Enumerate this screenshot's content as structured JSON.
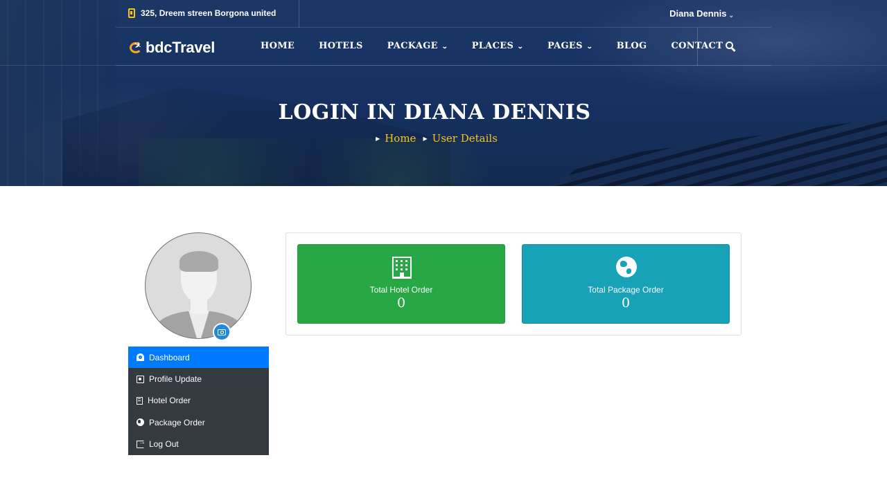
{
  "topbar": {
    "address": "325, Dreem streen Borgona united",
    "user_name": "Diana Dennis",
    "user_caret": "⌄"
  },
  "brand": {
    "logo_text": "bdcTravel"
  },
  "nav": {
    "items": [
      {
        "label": "HOME",
        "has_dropdown": false
      },
      {
        "label": "HOTELS",
        "has_dropdown": false
      },
      {
        "label": "PACKAGE",
        "has_dropdown": true
      },
      {
        "label": "PLACES",
        "has_dropdown": true
      },
      {
        "label": "PAGES",
        "has_dropdown": true
      },
      {
        "label": "BLOG",
        "has_dropdown": false
      },
      {
        "label": "CONTACT",
        "has_dropdown": false
      }
    ],
    "chevron": "⌄",
    "search_icon": "search-icon"
  },
  "hero": {
    "title": "LOGIN IN DIANA DENNIS",
    "breadcrumb": [
      "Home",
      "User Details"
    ],
    "breadcrumb_arrow": "▶"
  },
  "profile": {
    "avatar_icon": "user-placeholder-avatar",
    "camera_icon": "camera-icon"
  },
  "sidebar": {
    "items": [
      {
        "label": "Dashboard",
        "icon": "tachometer-icon",
        "active": true
      },
      {
        "label": "Profile Update",
        "icon": "address-card-icon",
        "active": false
      },
      {
        "label": "Hotel Order",
        "icon": "building-icon",
        "active": false
      },
      {
        "label": "Package Order",
        "icon": "globe-icon",
        "active": false
      },
      {
        "label": "Log Out",
        "icon": "sign-out-icon",
        "active": false
      }
    ]
  },
  "stats": [
    {
      "label": "Total Hotel Order",
      "value": "0",
      "icon": "building-icon",
      "color": "#28a745"
    },
    {
      "label": "Total Package Order",
      "value": "0",
      "icon": "globe-icon",
      "color": "#17a2b8"
    }
  ],
  "colors": {
    "accent_yellow": "#f5c518",
    "sidebar_bg": "#343a40",
    "sidebar_active": "#007bff",
    "success": "#28a745",
    "info": "#17a2b8"
  }
}
